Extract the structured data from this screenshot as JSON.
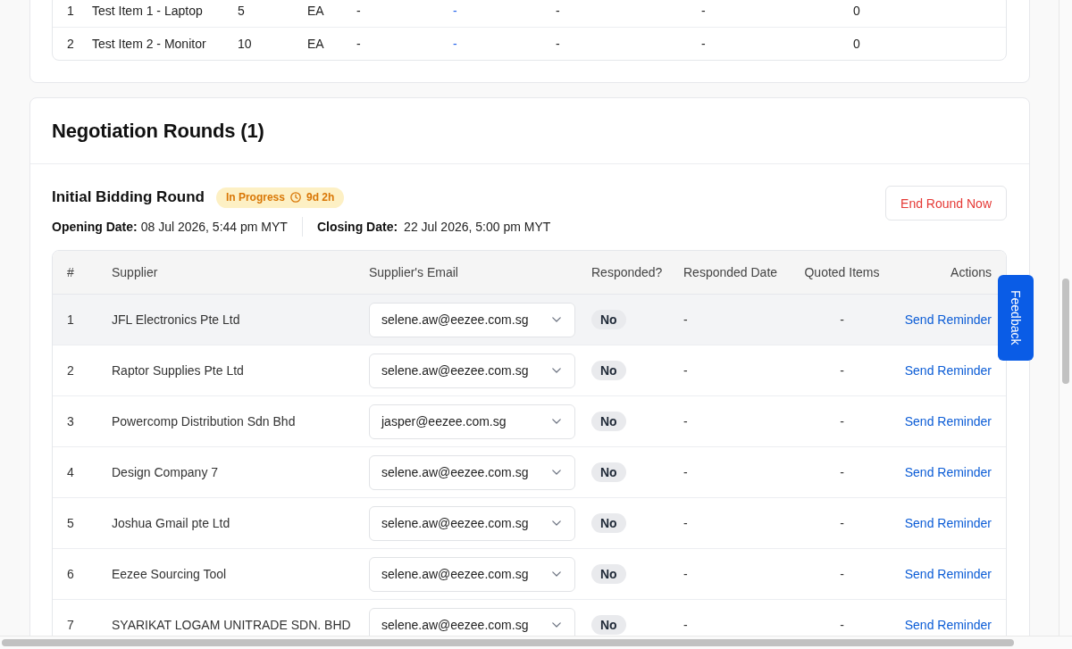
{
  "items_table": {
    "rows": [
      {
        "cells": [
          {
            "text": "1",
            "kind": "text"
          },
          {
            "text": "Test Item 1 - Laptop",
            "kind": "text"
          },
          {
            "text": "5",
            "kind": "text"
          },
          {
            "text": "EA",
            "kind": "text"
          },
          {
            "text": "-",
            "kind": "text"
          },
          {
            "text": "-",
            "kind": "link"
          },
          {
            "text": "-",
            "kind": "text"
          },
          {
            "text": "-",
            "kind": "text"
          },
          {
            "text": "0",
            "kind": "text"
          }
        ]
      },
      {
        "cells": [
          {
            "text": "2",
            "kind": "text"
          },
          {
            "text": "Test Item 2 - Monitor",
            "kind": "text"
          },
          {
            "text": "10",
            "kind": "text"
          },
          {
            "text": "EA",
            "kind": "text"
          },
          {
            "text": "-",
            "kind": "text"
          },
          {
            "text": "-",
            "kind": "link"
          },
          {
            "text": "-",
            "kind": "text"
          },
          {
            "text": "-",
            "kind": "text"
          },
          {
            "text": "0",
            "kind": "text"
          }
        ]
      }
    ]
  },
  "negotiation": {
    "title": "Negotiation Rounds (1)",
    "rounds": [
      {
        "name": "Initial Bidding Round",
        "status": {
          "label": "In Progress",
          "time_left": "9d 2h",
          "kind": "in_progress"
        },
        "end_button": "End Round Now",
        "opening": {
          "label": "Opening Date:",
          "value": "08 Jul 2026, 5:44 pm MYT"
        },
        "closing": {
          "label": "Closing Date:",
          "value": "22 Jul 2026, 5:00 pm MYT"
        },
        "table": {
          "columns": [
            "#",
            "Supplier",
            "Supplier's Email",
            "Responded?",
            "Responded Date",
            "Quoted Items",
            "Actions"
          ],
          "rows": [
            {
              "no": "1",
              "supplier": "JFL Electronics Pte Ltd",
              "email": "selene.aw@eezee.com.sg",
              "responded": "No",
              "responded_date": "-",
              "quoted_items": "-",
              "action": "Send Reminder",
              "highlighted": true
            },
            {
              "no": "2",
              "supplier": "Raptor Supplies Pte Ltd",
              "email": "selene.aw@eezee.com.sg",
              "responded": "No",
              "responded_date": "-",
              "quoted_items": "-",
              "action": "Send Reminder",
              "highlighted": false
            },
            {
              "no": "3",
              "supplier": "Powercomp Distribution Sdn Bhd",
              "email": "jasper@eezee.com.sg",
              "responded": "No",
              "responded_date": "-",
              "quoted_items": "-",
              "action": "Send Reminder",
              "highlighted": false
            },
            {
              "no": "4",
              "supplier": "Design Company 7",
              "email": "selene.aw@eezee.com.sg",
              "responded": "No",
              "responded_date": "-",
              "quoted_items": "-",
              "action": "Send Reminder",
              "highlighted": false
            },
            {
              "no": "5",
              "supplier": "Joshua Gmail pte Ltd",
              "email": "selene.aw@eezee.com.sg",
              "responded": "No",
              "responded_date": "-",
              "quoted_items": "-",
              "action": "Send Reminder",
              "highlighted": false
            },
            {
              "no": "6",
              "supplier": "Eezee Sourcing Tool",
              "email": "selene.aw@eezee.com.sg",
              "responded": "No",
              "responded_date": "-",
              "quoted_items": "-",
              "action": "Send Reminder",
              "highlighted": false
            },
            {
              "no": "7",
              "supplier": "SYARIKAT LOGAM UNITRADE SDN. BHD",
              "email": "selene.aw@eezee.com.sg",
              "responded": "No",
              "responded_date": "-",
              "quoted_items": "-",
              "action": "Send Reminder",
              "highlighted": false
            }
          ]
        }
      }
    ]
  },
  "feedback_tab": "Feedback"
}
